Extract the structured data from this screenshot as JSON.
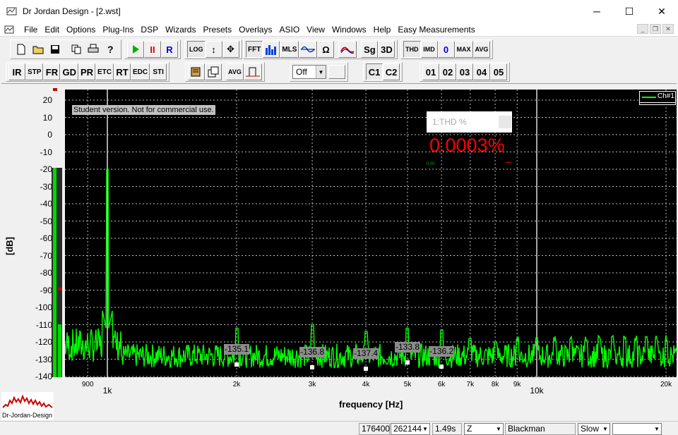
{
  "window": {
    "title": "Dr Jordan Design - [2.wst]",
    "minimize": "─",
    "maximize": "☐",
    "close": "✕"
  },
  "menu": [
    "File",
    "Edit",
    "Options",
    "Plug-Ins",
    "DSP",
    "Wizards",
    "Presets",
    "Overlays",
    "ASIO",
    "View",
    "Windows",
    "Help",
    "Easy Measurements"
  ],
  "toolbar1": {
    "log": "LOG",
    "fft": "FFT",
    "mls": "MLS",
    "omega": "Ω",
    "sg": "Sg",
    "three_d": "3D",
    "thd": "THD",
    "imd": "IMD",
    "zero": "0",
    "max": "MAX",
    "avg": "AVG"
  },
  "toolbar2": {
    "buttons": [
      "IR",
      "STP",
      "FR",
      "GD",
      "PR",
      "ETC",
      "RT",
      "EDC",
      "STI"
    ],
    "avg": "AVG",
    "select_value": "Off",
    "channels": [
      "C1",
      "C2"
    ],
    "presets": [
      "01",
      "02",
      "03",
      "04",
      "05"
    ]
  },
  "graph": {
    "ylabel": "[dB]",
    "xlabel": "frequency [Hz]",
    "yticks": [
      "20",
      "10",
      "0",
      "-10",
      "-20",
      "-30",
      "-40",
      "-50",
      "-60",
      "-70",
      "-80",
      "-90",
      "-100",
      "-110",
      "-120",
      "-130",
      "-140"
    ],
    "xticks": [
      "900",
      "1k",
      "2k",
      "3k",
      "4k",
      "5k",
      "6k",
      "7k",
      "8k",
      "9k",
      "10k",
      "20k"
    ],
    "student_note": "Student version. Not for commercial use.",
    "legend": "Ch#1",
    "thd_title": "1:THD %",
    "thd_value": "0.0003%",
    "thd_small": "0.00",
    "harmonics": [
      "-135.1",
      "-136.8",
      "-137.4",
      "-133.8",
      "-136.2"
    ],
    "trace_color": "#00ff00"
  },
  "logo": "Dr-Jordan-Design",
  "status": {
    "rate": "176400",
    "size": "262144",
    "time": "1.49s",
    "scale": "Z",
    "window": "Blackman",
    "speed": "Slow",
    "extra": ""
  }
}
